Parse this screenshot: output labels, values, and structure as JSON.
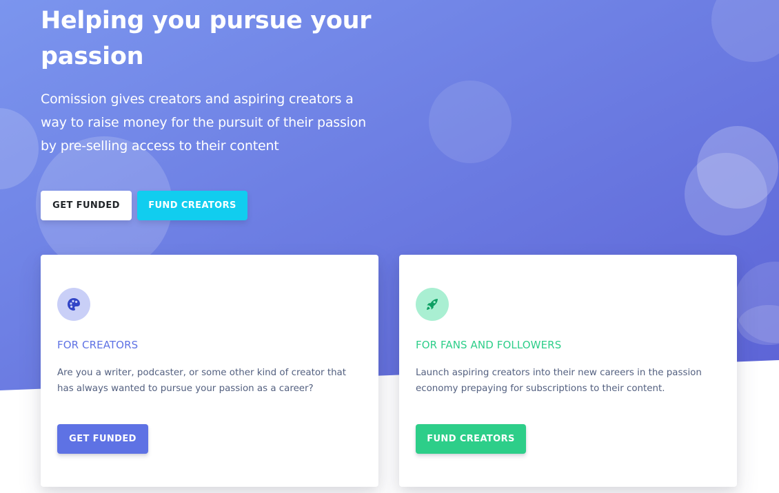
{
  "hero": {
    "title": "Helping you pursue your passion",
    "description": "Comission gives creators and aspiring creators a way to raise money for the pursuit of their passion by pre-selling access to their content",
    "buttons": {
      "get_funded": "GET FUNDED",
      "fund_creators": "FUND CREATORS"
    },
    "gradient_start": "#7b95ee",
    "gradient_end": "#6068d8"
  },
  "cards": {
    "creators": {
      "icon": "palette-icon",
      "title": "FOR CREATORS",
      "text": "Are you a writer, podcaster, or some other kind of creator that has always wanted to pursue your passion as a career?",
      "button": "GET FUNDED",
      "accent": "#5e72e4",
      "icon_bg": "#c9cff7"
    },
    "fans": {
      "icon": "rocket-icon",
      "title": "FOR FANS AND FOLLOWERS",
      "text": "Launch aspiring creators into their new careers in the passion economy prepaying for subscriptions to their content.",
      "button": "FUND CREATORS",
      "accent": "#2dce89",
      "icon_bg": "#a9efd2"
    }
  },
  "colors": {
    "white_button_text": "#212529",
    "cyan_button": "#11cdef",
    "body_text": "#525f7f"
  }
}
